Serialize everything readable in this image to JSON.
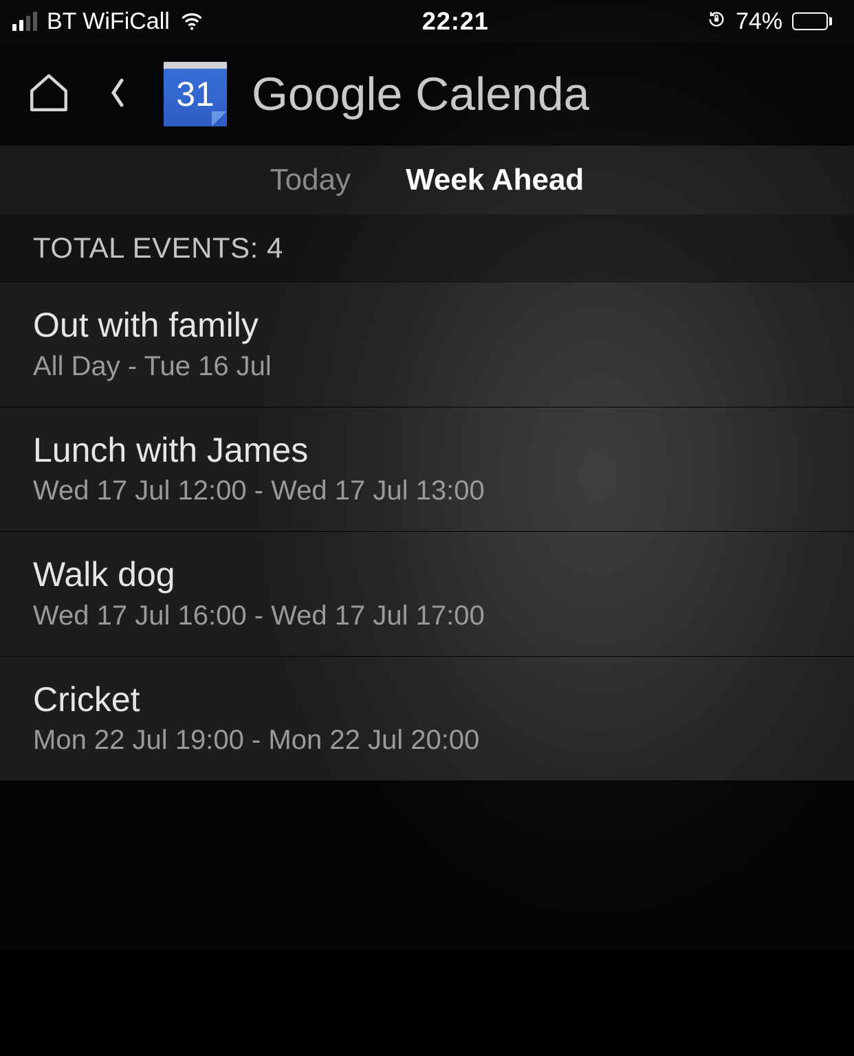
{
  "statusbar": {
    "carrier": "BT WiFiCall",
    "time": "22:21",
    "battery_pct_label": "74%",
    "battery_fill_pct": 74
  },
  "header": {
    "calendar_icon_day": "31",
    "title": "Google Calenda"
  },
  "tabs": {
    "today_label": "Today",
    "week_ahead_label": "Week Ahead",
    "active": "week_ahead"
  },
  "summary": {
    "label": "TOTAL EVENTS: 4"
  },
  "events": [
    {
      "title": "Out with family",
      "time": "All Day - Tue 16 Jul"
    },
    {
      "title": "Lunch with James",
      "time": "Wed 17 Jul 12:00 - Wed 17 Jul 13:00"
    },
    {
      "title": "Walk dog",
      "time": "Wed 17 Jul 16:00 - Wed 17 Jul 17:00"
    },
    {
      "title": "Cricket",
      "time": "Mon 22 Jul 19:00 - Mon 22 Jul 20:00"
    }
  ]
}
